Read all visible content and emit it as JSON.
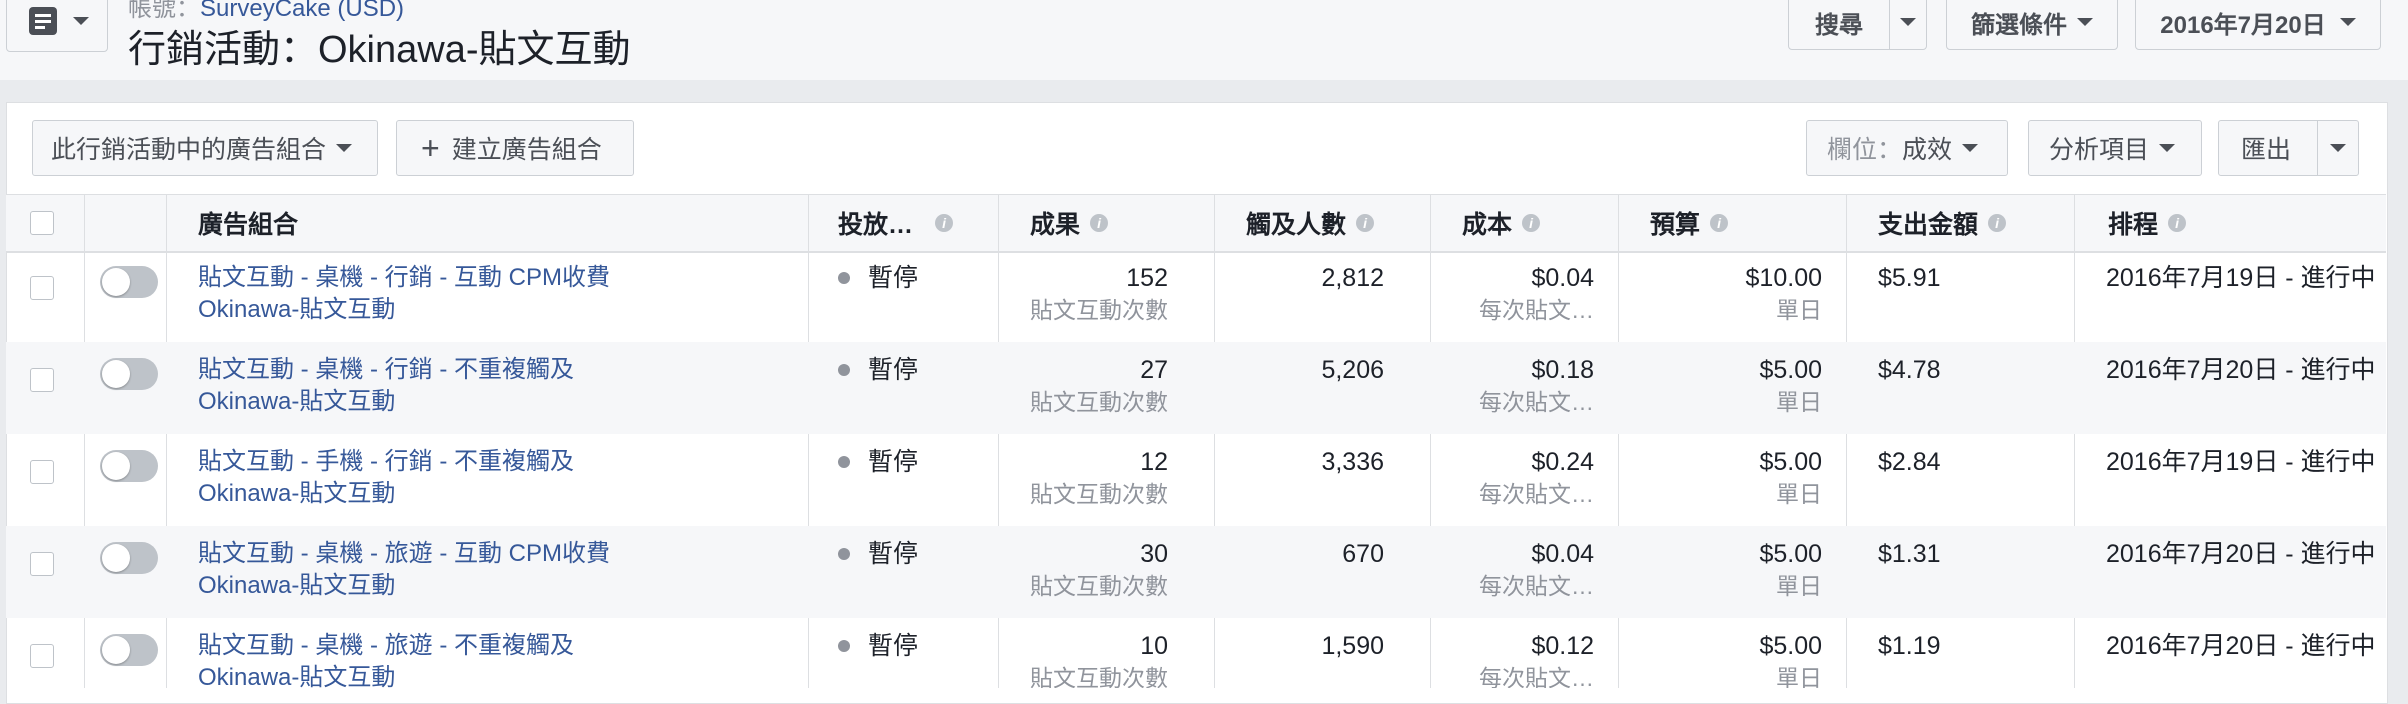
{
  "header": {
    "breadcrumb_prefix": "帳號：",
    "breadcrumb_account": "SurveyCake (USD)",
    "title": "行銷活動：Okinawa-貼文互動",
    "search_label": "搜尋",
    "filter_label": "篩選條件",
    "date_label": "2016年7月20日"
  },
  "toolbar": {
    "adsets_dropdown": "此行銷活動中的廣告組合",
    "create_button": "建立廣告組合",
    "columns_prefix": "欄位：",
    "columns_value": "成效",
    "breakdown_label": "分析項目",
    "export_label": "匯出"
  },
  "columns": {
    "adset": "廣告組合",
    "delivery": "投放…",
    "results": "成果",
    "reach": "觸及人數",
    "cost": "成本",
    "budget": "預算",
    "spent": "支出金額",
    "schedule": "排程"
  },
  "rows": [
    {
      "name": "貼文互動 - 桌機 - 行銷 - 互動 CPM收費",
      "campaign": "Okinawa-貼文互動",
      "status": "暫停",
      "results": "152",
      "results_type": "貼文互動次數",
      "reach": "2,812",
      "cost": "$0.04",
      "cost_type": "每次貼文…",
      "budget": "$10.00",
      "budget_type": "單日",
      "spent": "$5.91",
      "schedule": "2016年7月19日 - 進行中"
    },
    {
      "name": "貼文互動 - 桌機 - 行銷 - 不重複觸及",
      "campaign": "Okinawa-貼文互動",
      "status": "暫停",
      "results": "27",
      "results_type": "貼文互動次數",
      "reach": "5,206",
      "cost": "$0.18",
      "cost_type": "每次貼文…",
      "budget": "$5.00",
      "budget_type": "單日",
      "spent": "$4.78",
      "schedule": "2016年7月20日 - 進行中"
    },
    {
      "name": "貼文互動 - 手機 - 行銷 - 不重複觸及",
      "campaign": "Okinawa-貼文互動",
      "status": "暫停",
      "results": "12",
      "results_type": "貼文互動次數",
      "reach": "3,336",
      "cost": "$0.24",
      "cost_type": "每次貼文…",
      "budget": "$5.00",
      "budget_type": "單日",
      "spent": "$2.84",
      "schedule": "2016年7月19日 - 進行中"
    },
    {
      "name": "貼文互動 - 桌機 - 旅遊 - 互動 CPM收費",
      "campaign": "Okinawa-貼文互動",
      "status": "暫停",
      "results": "30",
      "results_type": "貼文互動次數",
      "reach": "670",
      "cost": "$0.04",
      "cost_type": "每次貼文…",
      "budget": "$5.00",
      "budget_type": "單日",
      "spent": "$1.31",
      "schedule": "2016年7月20日 - 進行中"
    },
    {
      "name": "貼文互動 - 桌機 - 旅遊 - 不重複觸及",
      "campaign": "Okinawa-貼文互動",
      "status": "暫停",
      "results": "10",
      "results_type": "貼文互動次數",
      "reach": "1,590",
      "cost": "$0.12",
      "cost_type": "每次貼文…",
      "budget": "$5.00",
      "budget_type": "單日",
      "spent": "$1.19",
      "schedule": "2016年7月20日 - 進行中"
    }
  ]
}
